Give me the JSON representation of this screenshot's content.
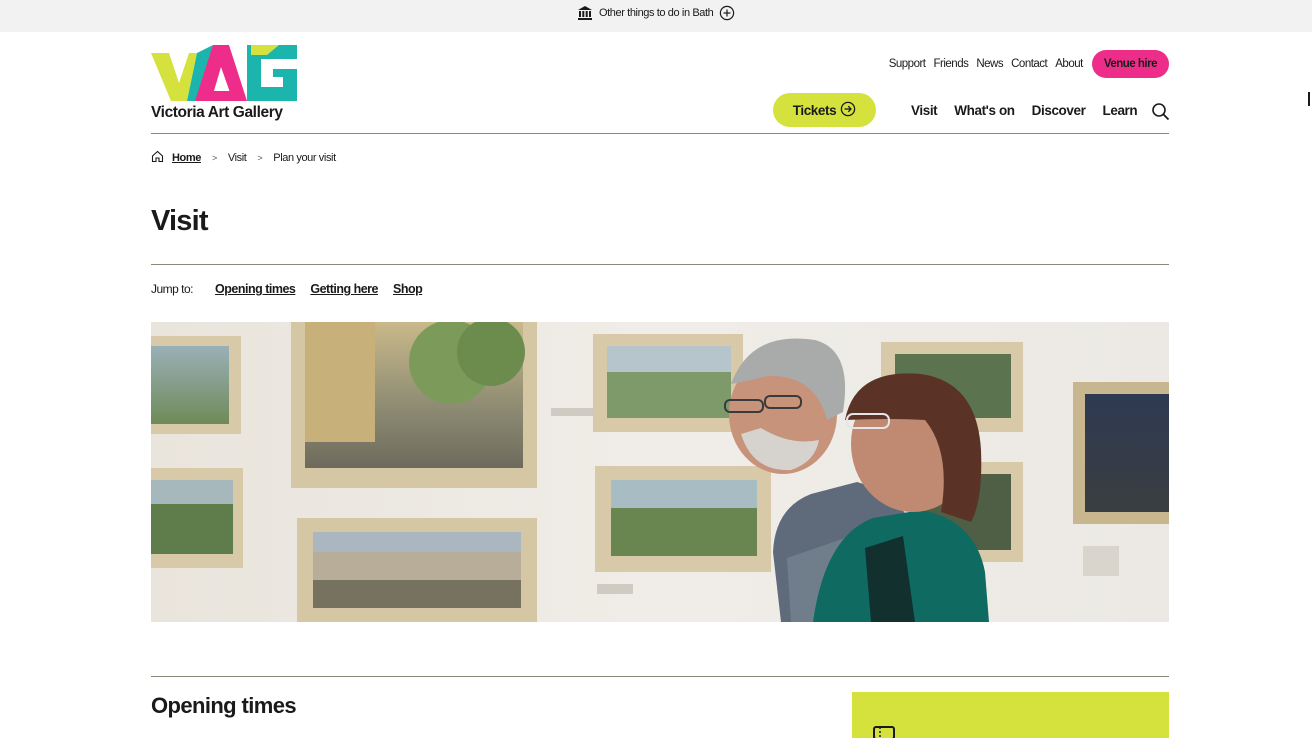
{
  "topbar": {
    "label": "Other things to do in Bath",
    "icon": "museum-icon",
    "action_icon": "plus-circle-icon"
  },
  "logo": {
    "mark": "VAG",
    "name": "Victoria Art Gallery",
    "colors": {
      "lime": "#d5e23e",
      "pink": "#ee2d8b",
      "teal": "#1bb5ad"
    }
  },
  "utility_nav": {
    "items": [
      "Support",
      "Friends",
      "News",
      "Contact",
      "About"
    ],
    "venue_hire": "Venue hire"
  },
  "tickets": {
    "label": "Tickets",
    "icon": "arrow-right-circle-icon"
  },
  "main_nav": {
    "items": [
      "Visit",
      "What's on",
      "Discover",
      "Learn"
    ],
    "search_icon": "search-icon"
  },
  "breadcrumb": {
    "home": "Home",
    "items": [
      "Visit",
      "Plan your visit"
    ],
    "separator": ">"
  },
  "page": {
    "title": "Visit"
  },
  "jump_to": {
    "label": "Jump to:",
    "links": [
      "Opening times",
      "Getting here",
      "Shop"
    ]
  },
  "hero": {
    "icon": "gallery-photo"
  },
  "opening_times": {
    "title": "Opening times"
  },
  "promo": {
    "icon": "ticket-icon"
  },
  "colors": {
    "accent_lime": "#d5e23e",
    "accent_pink": "#ee2d8b",
    "text": "#1a1a1a"
  }
}
